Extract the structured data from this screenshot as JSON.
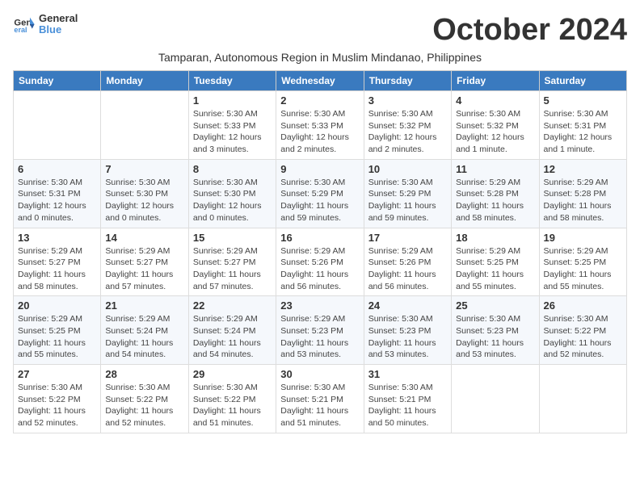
{
  "logo": {
    "general": "General",
    "blue": "Blue"
  },
  "title": "October 2024",
  "subtitle": "Tamparan, Autonomous Region in Muslim Mindanao, Philippines",
  "headers": [
    "Sunday",
    "Monday",
    "Tuesday",
    "Wednesday",
    "Thursday",
    "Friday",
    "Saturday"
  ],
  "weeks": [
    [
      {
        "day": "",
        "info": ""
      },
      {
        "day": "",
        "info": ""
      },
      {
        "day": "1",
        "info": "Sunrise: 5:30 AM\nSunset: 5:33 PM\nDaylight: 12 hours and 3 minutes."
      },
      {
        "day": "2",
        "info": "Sunrise: 5:30 AM\nSunset: 5:33 PM\nDaylight: 12 hours and 2 minutes."
      },
      {
        "day": "3",
        "info": "Sunrise: 5:30 AM\nSunset: 5:32 PM\nDaylight: 12 hours and 2 minutes."
      },
      {
        "day": "4",
        "info": "Sunrise: 5:30 AM\nSunset: 5:32 PM\nDaylight: 12 hours and 1 minute."
      },
      {
        "day": "5",
        "info": "Sunrise: 5:30 AM\nSunset: 5:31 PM\nDaylight: 12 hours and 1 minute."
      }
    ],
    [
      {
        "day": "6",
        "info": "Sunrise: 5:30 AM\nSunset: 5:31 PM\nDaylight: 12 hours and 0 minutes."
      },
      {
        "day": "7",
        "info": "Sunrise: 5:30 AM\nSunset: 5:30 PM\nDaylight: 12 hours and 0 minutes."
      },
      {
        "day": "8",
        "info": "Sunrise: 5:30 AM\nSunset: 5:30 PM\nDaylight: 12 hours and 0 minutes."
      },
      {
        "day": "9",
        "info": "Sunrise: 5:30 AM\nSunset: 5:29 PM\nDaylight: 11 hours and 59 minutes."
      },
      {
        "day": "10",
        "info": "Sunrise: 5:30 AM\nSunset: 5:29 PM\nDaylight: 11 hours and 59 minutes."
      },
      {
        "day": "11",
        "info": "Sunrise: 5:29 AM\nSunset: 5:28 PM\nDaylight: 11 hours and 58 minutes."
      },
      {
        "day": "12",
        "info": "Sunrise: 5:29 AM\nSunset: 5:28 PM\nDaylight: 11 hours and 58 minutes."
      }
    ],
    [
      {
        "day": "13",
        "info": "Sunrise: 5:29 AM\nSunset: 5:27 PM\nDaylight: 11 hours and 58 minutes."
      },
      {
        "day": "14",
        "info": "Sunrise: 5:29 AM\nSunset: 5:27 PM\nDaylight: 11 hours and 57 minutes."
      },
      {
        "day": "15",
        "info": "Sunrise: 5:29 AM\nSunset: 5:27 PM\nDaylight: 11 hours and 57 minutes."
      },
      {
        "day": "16",
        "info": "Sunrise: 5:29 AM\nSunset: 5:26 PM\nDaylight: 11 hours and 56 minutes."
      },
      {
        "day": "17",
        "info": "Sunrise: 5:29 AM\nSunset: 5:26 PM\nDaylight: 11 hours and 56 minutes."
      },
      {
        "day": "18",
        "info": "Sunrise: 5:29 AM\nSunset: 5:25 PM\nDaylight: 11 hours and 55 minutes."
      },
      {
        "day": "19",
        "info": "Sunrise: 5:29 AM\nSunset: 5:25 PM\nDaylight: 11 hours and 55 minutes."
      }
    ],
    [
      {
        "day": "20",
        "info": "Sunrise: 5:29 AM\nSunset: 5:25 PM\nDaylight: 11 hours and 55 minutes."
      },
      {
        "day": "21",
        "info": "Sunrise: 5:29 AM\nSunset: 5:24 PM\nDaylight: 11 hours and 54 minutes."
      },
      {
        "day": "22",
        "info": "Sunrise: 5:29 AM\nSunset: 5:24 PM\nDaylight: 11 hours and 54 minutes."
      },
      {
        "day": "23",
        "info": "Sunrise: 5:29 AM\nSunset: 5:23 PM\nDaylight: 11 hours and 53 minutes."
      },
      {
        "day": "24",
        "info": "Sunrise: 5:30 AM\nSunset: 5:23 PM\nDaylight: 11 hours and 53 minutes."
      },
      {
        "day": "25",
        "info": "Sunrise: 5:30 AM\nSunset: 5:23 PM\nDaylight: 11 hours and 53 minutes."
      },
      {
        "day": "26",
        "info": "Sunrise: 5:30 AM\nSunset: 5:22 PM\nDaylight: 11 hours and 52 minutes."
      }
    ],
    [
      {
        "day": "27",
        "info": "Sunrise: 5:30 AM\nSunset: 5:22 PM\nDaylight: 11 hours and 52 minutes."
      },
      {
        "day": "28",
        "info": "Sunrise: 5:30 AM\nSunset: 5:22 PM\nDaylight: 11 hours and 52 minutes."
      },
      {
        "day": "29",
        "info": "Sunrise: 5:30 AM\nSunset: 5:22 PM\nDaylight: 11 hours and 51 minutes."
      },
      {
        "day": "30",
        "info": "Sunrise: 5:30 AM\nSunset: 5:21 PM\nDaylight: 11 hours and 51 minutes."
      },
      {
        "day": "31",
        "info": "Sunrise: 5:30 AM\nSunset: 5:21 PM\nDaylight: 11 hours and 50 minutes."
      },
      {
        "day": "",
        "info": ""
      },
      {
        "day": "",
        "info": ""
      }
    ]
  ]
}
